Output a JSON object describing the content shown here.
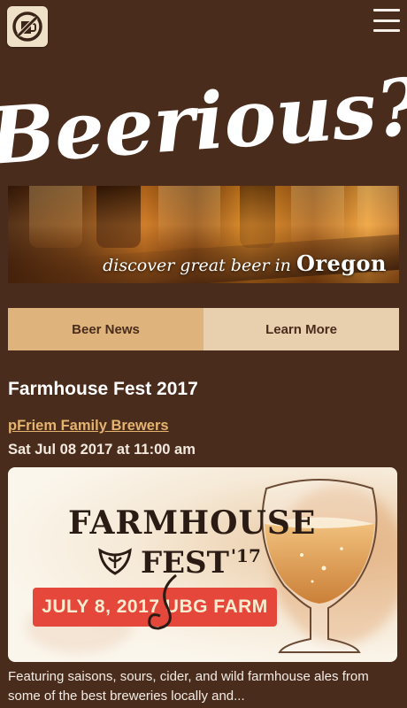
{
  "header": {
    "logo_icon": "no-beer-logo-icon",
    "menu_icon": "hamburger-menu-icon",
    "brand_title": "Beerious?"
  },
  "banner": {
    "tagline_prefix": "discover great beer in",
    "tagline_state": "Oregon"
  },
  "tabs": [
    {
      "label": "Beer News",
      "active": true
    },
    {
      "label": "Learn More",
      "active": false
    }
  ],
  "article": {
    "title": "Farmhouse Fest 2017",
    "brewery": "pFriem Family Brewers",
    "date": "Sat Jul 08 2017 at 11:00 am",
    "poster": {
      "title": "FARMHOUSE",
      "fest": "FEST",
      "year": "'17",
      "ribbon": "JULY 8, 2017  UBG FARM"
    },
    "excerpt": "Featuring saisons, sours, cider, and wild farmhouse ales from some of the best breweries locally and..."
  },
  "colors": {
    "background": "#4a2c1d",
    "tab_active": "#dfb47c",
    "tab_inactive": "#e8cfae",
    "link": "#e5b46f",
    "ribbon": "#e5473b"
  }
}
